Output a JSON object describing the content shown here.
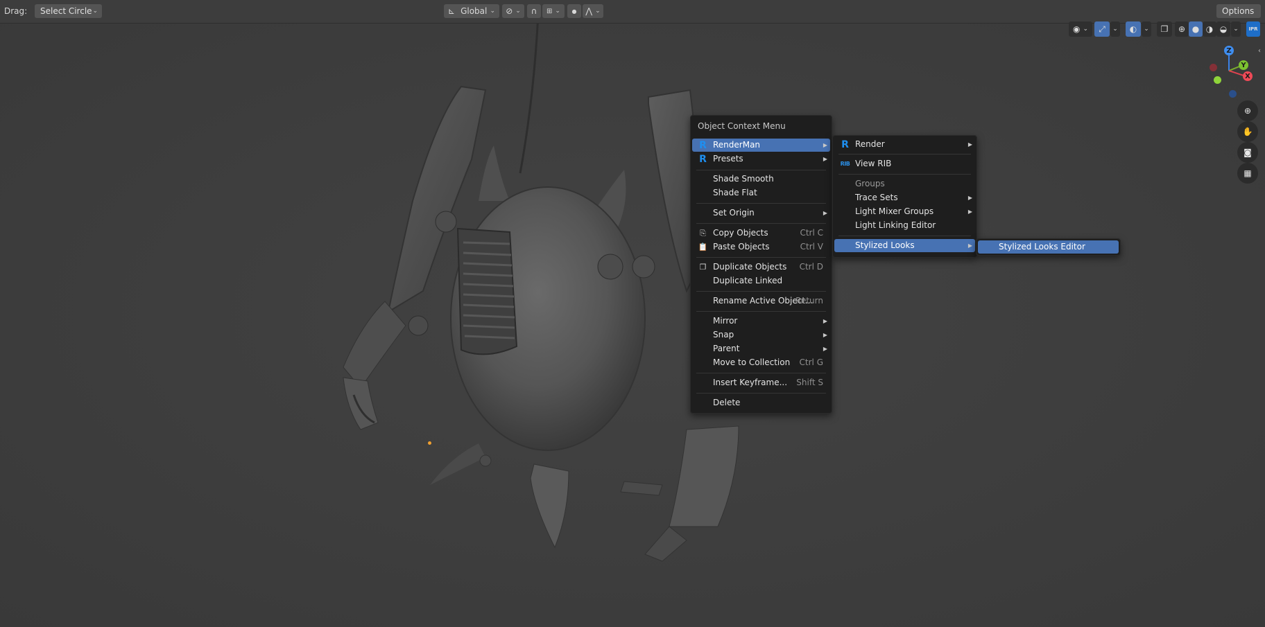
{
  "header": {
    "drag_label": "Drag:",
    "drag_mode": "Select Circle",
    "orientation": "Global",
    "options_label": "Options"
  },
  "gizmo": {
    "z": "Z",
    "y": "Y",
    "x": "X"
  },
  "object_menu": {
    "title": "Object Context Menu",
    "items": [
      {
        "label": "RenderMan",
        "icon": "renderman-icon",
        "submenu": true,
        "active": true
      },
      {
        "label": "Presets",
        "icon": "renderman-icon",
        "submenu": true
      },
      {
        "label": "Shade Smooth"
      },
      {
        "label": "Shade Flat"
      },
      {
        "label": "Set Origin",
        "submenu": true
      },
      {
        "label": "Copy Objects",
        "icon": "copy-icon",
        "shortcut": "Ctrl C"
      },
      {
        "label": "Paste Objects",
        "icon": "paste-icon",
        "shortcut": "Ctrl V"
      },
      {
        "label": "Duplicate Objects",
        "icon": "duplicate-icon",
        "shortcut": "Ctrl D"
      },
      {
        "label": "Duplicate Linked"
      },
      {
        "label": "Rename Active Object...",
        "shortcut": "Return"
      },
      {
        "label": "Mirror",
        "submenu": true
      },
      {
        "label": "Snap",
        "submenu": true
      },
      {
        "label": "Parent",
        "submenu": true
      },
      {
        "label": "Move to Collection",
        "shortcut": "Ctrl G"
      },
      {
        "label": "Insert Keyframe...",
        "shortcut": "Shift S"
      },
      {
        "label": "Delete"
      }
    ]
  },
  "renderman_menu": {
    "items": [
      {
        "label": "Render",
        "icon": "renderman-icon",
        "submenu": true
      },
      {
        "label": "View RIB",
        "icon": "rib-icon",
        "icon_text": "RIB"
      },
      {
        "label": "Groups",
        "header": true
      },
      {
        "label": "Trace Sets",
        "submenu": true
      },
      {
        "label": "Light Mixer Groups",
        "submenu": true
      },
      {
        "label": "Light Linking Editor"
      },
      {
        "label": "Stylized Looks",
        "submenu": true,
        "active": true
      }
    ]
  },
  "stylized_menu": {
    "items": [
      {
        "label": "Stylized Looks Editor",
        "active": true
      }
    ]
  },
  "colors": {
    "accent": "#4772b3",
    "menu_bg": "#1e1e1e",
    "viewport_bg": "#3d3d3d",
    "renderman_blue": "#1e8ff0"
  }
}
